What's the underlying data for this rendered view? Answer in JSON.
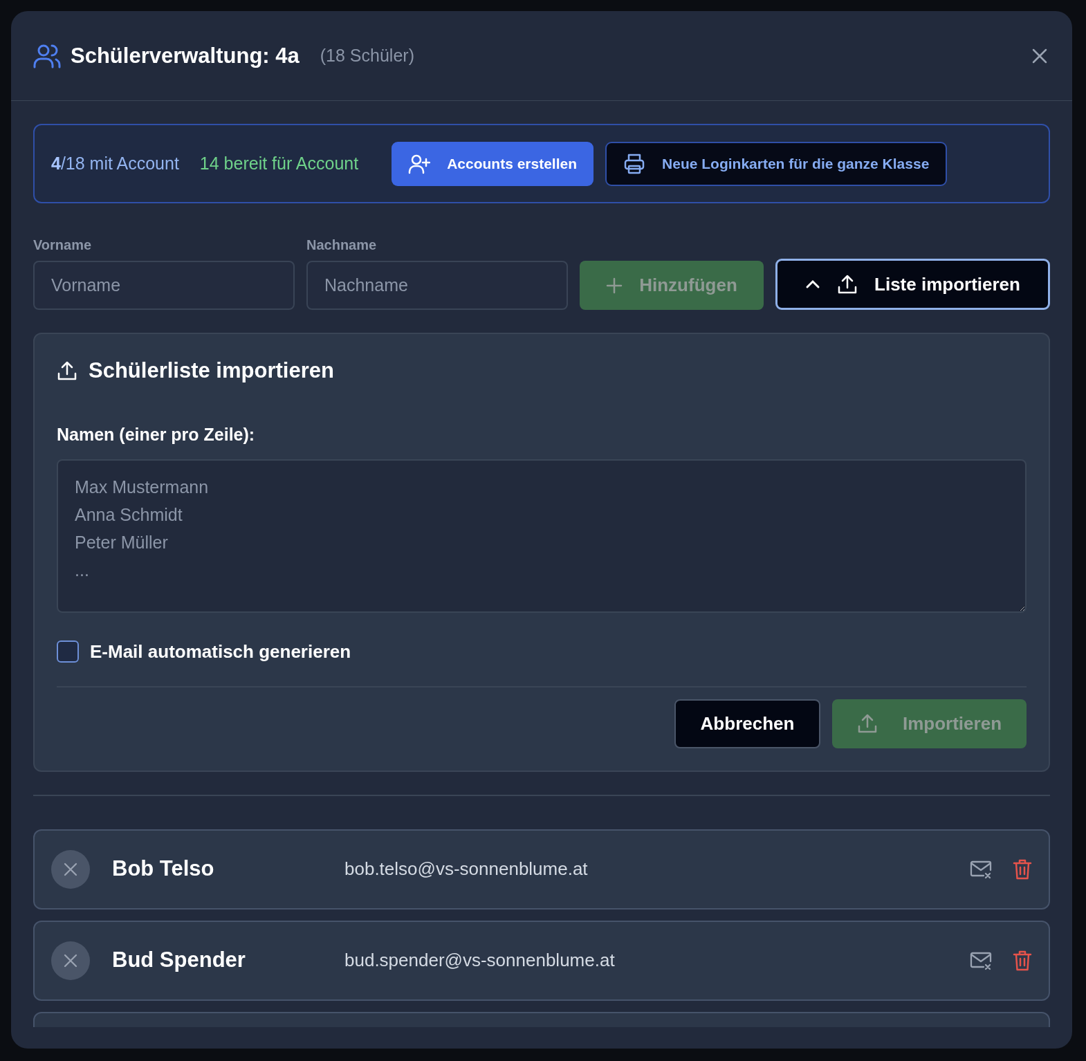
{
  "dialog": {
    "title": "Schülerverwaltung: 4a",
    "count": "(18 Schüler)"
  },
  "stats": {
    "with_account_count": "4",
    "with_account_rest": "/18 mit Account",
    "ready": "14 bereit für Account"
  },
  "stat_buttons": [
    {
      "label": "Accounts erstellen",
      "kind": "primary"
    },
    {
      "label": "Neue Loginkarten für die ganze Klasse",
      "kind": "outline"
    }
  ],
  "add_form": {
    "first_name": {
      "label": "Vorname",
      "placeholder": "Vorname"
    },
    "last_name": {
      "label": "Nachname",
      "placeholder": "Nachname"
    },
    "add_button": {
      "label": "Hinzufügen",
      "disabled": true
    },
    "import_toggle": {
      "label": "Liste importieren",
      "expanded": true
    }
  },
  "import_panel": {
    "title": "Schülerliste importieren",
    "names_label": "Namen (einer pro Zeile):",
    "names_placeholder": "Max Mustermann\nAnna Schmidt\nPeter Müller\n...",
    "auto_email": {
      "label": "E-Mail automatisch generieren",
      "checked": false
    },
    "cancel_button": "Abbrechen",
    "import_button": {
      "label": "Importieren",
      "disabled": true
    }
  },
  "students": [
    {
      "kind": "full",
      "name": "Bob Telso",
      "email": "bob.telso@vs-sonnenblume.at"
    },
    {
      "kind": "full",
      "name": "Bud Spender",
      "email": "bud.spender@vs-sonnenblume.at"
    },
    {
      "kind": "cut"
    }
  ]
}
